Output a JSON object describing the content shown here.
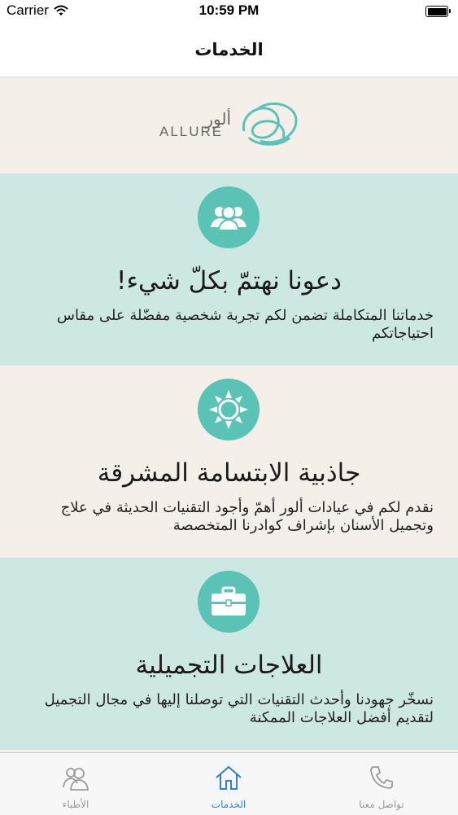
{
  "status_bar": {
    "carrier": "Carrier",
    "time": "10:59 PM"
  },
  "nav": {
    "title": "الخدمات"
  },
  "brand": {
    "name_ar": "ألور",
    "name_en": "ALLURE"
  },
  "cards": [
    {
      "title": "دعونا نهتمّ بكلّ شيء!",
      "description": "خدماتنا المتكاملة تضمن لكم تجربة شخصية مفضّلة على مقاس احتياجاتكم",
      "icon": "users-icon"
    },
    {
      "title": "جاذبية الابتسامة المشرقة",
      "description": "نقدم لكم في عيادات ألور أهمّ وأجود التقنيات الحديثة في علاج وتجميل الأسنان بإشراف كوادرنا المتخصصة",
      "icon": "sun-icon"
    },
    {
      "title": "العلاجات التجميلية",
      "description": "نسخّر جهودنا وأحدث التقنيات التي توصلنا إليها في مجال التجميل لتقديم أفضل العلاجات الممكنة",
      "icon": "briefcase-icon"
    }
  ],
  "tabs": [
    {
      "label": "تواصل معنا",
      "icon": "phone-icon",
      "active": false
    },
    {
      "label": "الخدمات",
      "icon": "home-icon",
      "active": true
    },
    {
      "label": "الأطباء",
      "icon": "doctors-icon",
      "active": false
    }
  ],
  "colors": {
    "teal_card": "#cde7e2",
    "beige": "#f4f0e9",
    "accent": "#5bc2b6",
    "tab_active": "#2f7ed8"
  }
}
